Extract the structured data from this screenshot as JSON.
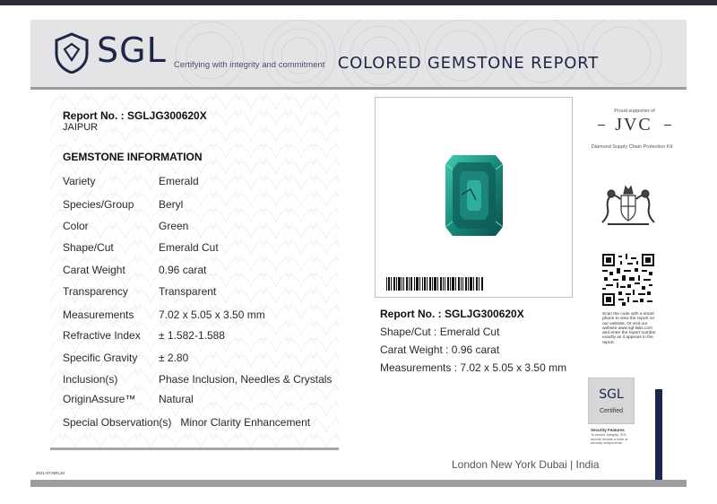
{
  "header": {
    "logo_text": "SGL",
    "tagline": "Certifying with integrity and commitment",
    "title": "COLORED GEMSTONE REPORT"
  },
  "report": {
    "report_no": "Report No. : SGLJG300620X",
    "city": "JAIPUR",
    "section_title": "GEMSTONE INFORMATION"
  },
  "info_rows": [
    {
      "label": "Variety",
      "value": "Emerald"
    },
    {
      "label": "Species/Group",
      "value": "Beryl"
    },
    {
      "label": "Color",
      "value": "Green"
    },
    {
      "label": "Shape/Cut",
      "value": "Emerald Cut"
    },
    {
      "label": "Carat Weight",
      "value": "0.96 carat"
    },
    {
      "label": "Transparency",
      "value": "Transparent"
    },
    {
      "label": "Measurements",
      "value": "7.02 x 5.05 x 3.50 mm"
    },
    {
      "label": "Refractive Index",
      "value": "± 1.582-1.588"
    },
    {
      "label": "Specific Gravity",
      "value": "± 2.80"
    },
    {
      "label": "Inclusion(s)",
      "value": "Phase Inclusion, Needles & Crystals"
    },
    {
      "label": "OriginAssure™",
      "value": "Natural"
    }
  ],
  "special": {
    "label": "Special Observation(s)",
    "value": "Minor Clarity Enhancement"
  },
  "summary": {
    "report_no": "Report No. : SGLJG300620X",
    "shape": "Shape/Cut : Emerald Cut",
    "carat": "Carat Weight : 0.96 carat",
    "measurements": "Measurements : 7.02 x 5.05 x 3.50 mm"
  },
  "jvc": {
    "supporter": "Proud supporter of",
    "logo": "JVC",
    "caption": "Diamond Supply Chain Protection Kit"
  },
  "qr_text": "Scan the code with a smart phone to view the report on our website. Or visit our website www.sgl-labs.com and enter the report number exactly as it appears in the report.",
  "certified": {
    "logo": "SGL",
    "label": "Certified"
  },
  "security": {
    "title": "Security Features",
    "text": "To ensure integrity, SGL reports include a suite of security components."
  },
  "locations": "London  New York  Dubai  |  India",
  "doc_code": "2021-07-NRL20",
  "colors": {
    "navy": "#1f2547",
    "emerald": "#1a8f7a",
    "accent_bar": "#1b2650"
  }
}
